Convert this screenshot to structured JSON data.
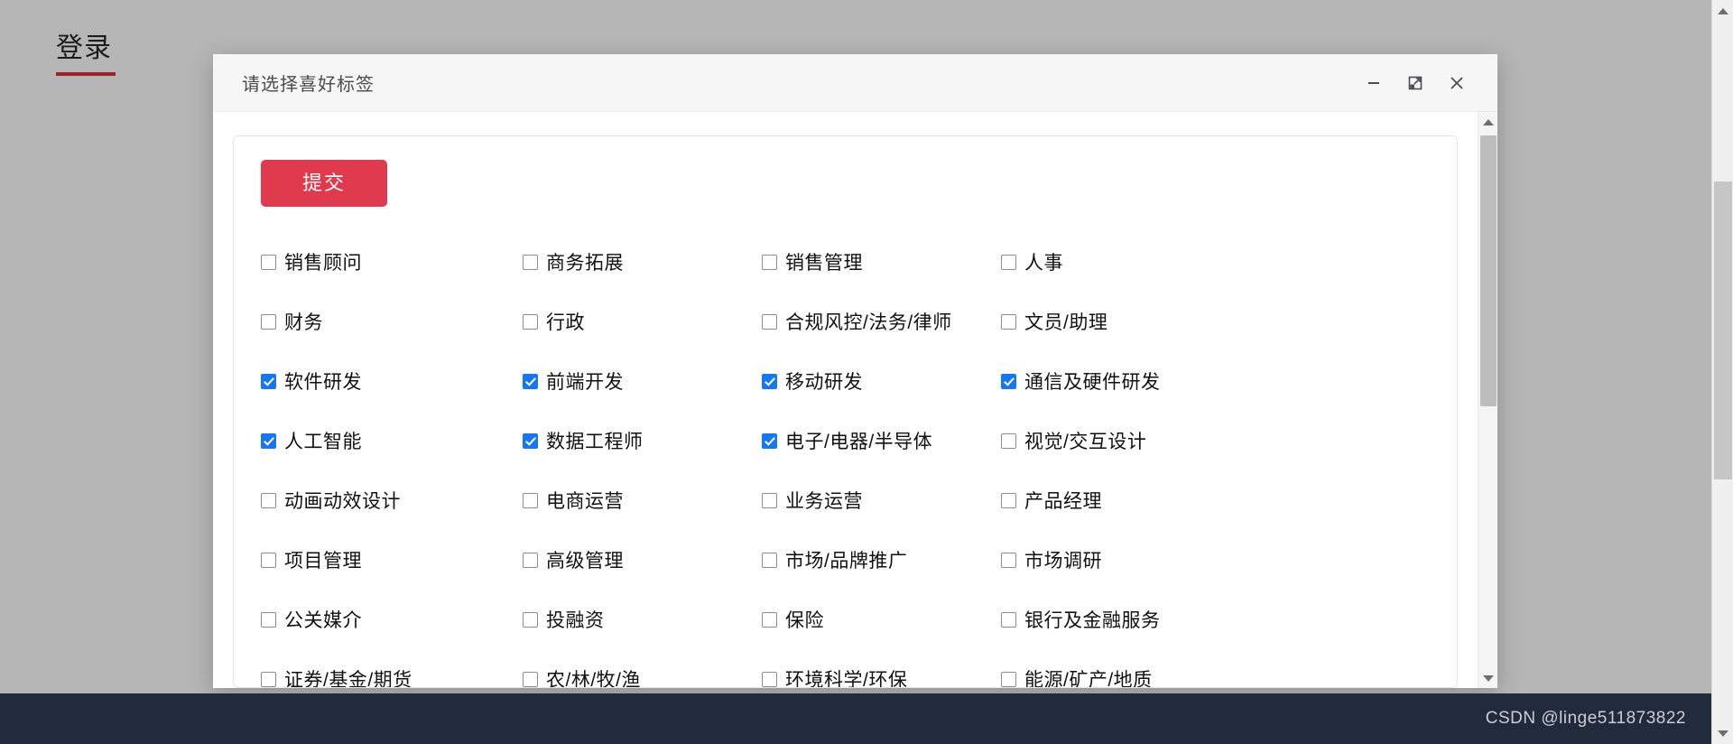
{
  "page": {
    "background_color": "#b6b6b6",
    "login_tab": {
      "label": "登录",
      "underline_color": "#9b2328"
    }
  },
  "dialog": {
    "title": "请选择喜好标签",
    "titlebar_background": "#f6f6f6",
    "window_controls": [
      {
        "name": "minimize",
        "glyph": "—"
      },
      {
        "name": "maximize",
        "glyph": "⤢"
      },
      {
        "name": "close",
        "glyph": "✕"
      }
    ],
    "submit_button": {
      "label": "提交",
      "color": "#e03a4e",
      "text_color": "#ffffff"
    },
    "checkbox_checked_color": "#1677f0",
    "tags": [
      {
        "label": "销售顾问",
        "checked": false
      },
      {
        "label": "商务拓展",
        "checked": false
      },
      {
        "label": "销售管理",
        "checked": false
      },
      {
        "label": "人事",
        "checked": false
      },
      {
        "label": "财务",
        "checked": false
      },
      {
        "label": "行政",
        "checked": false
      },
      {
        "label": "合规风控/法务/律师",
        "checked": false
      },
      {
        "label": "文员/助理",
        "checked": false
      },
      {
        "label": "软件研发",
        "checked": true
      },
      {
        "label": "前端开发",
        "checked": true
      },
      {
        "label": "移动研发",
        "checked": true
      },
      {
        "label": "通信及硬件研发",
        "checked": true
      },
      {
        "label": "人工智能",
        "checked": true
      },
      {
        "label": "数据工程师",
        "checked": true
      },
      {
        "label": "电子/电器/半导体",
        "checked": true
      },
      {
        "label": "视觉/交互设计",
        "checked": false
      },
      {
        "label": "动画动效设计",
        "checked": false
      },
      {
        "label": "电商运营",
        "checked": false
      },
      {
        "label": "业务运营",
        "checked": false
      },
      {
        "label": "产品经理",
        "checked": false
      },
      {
        "label": "项目管理",
        "checked": false
      },
      {
        "label": "高级管理",
        "checked": false
      },
      {
        "label": "市场/品牌推广",
        "checked": false
      },
      {
        "label": "市场调研",
        "checked": false
      },
      {
        "label": "公关媒介",
        "checked": false
      },
      {
        "label": "投融资",
        "checked": false
      },
      {
        "label": "保险",
        "checked": false
      },
      {
        "label": "银行及金融服务",
        "checked": false
      },
      {
        "label": "证券/基金/期货",
        "checked": false
      },
      {
        "label": "农/林/牧/渔",
        "checked": false
      },
      {
        "label": "环境科学/环保",
        "checked": false
      },
      {
        "label": "能源/矿产/地质",
        "checked": false
      }
    ]
  },
  "watermark": {
    "text": "CSDN @linge511873822",
    "background": "#222b3c"
  }
}
